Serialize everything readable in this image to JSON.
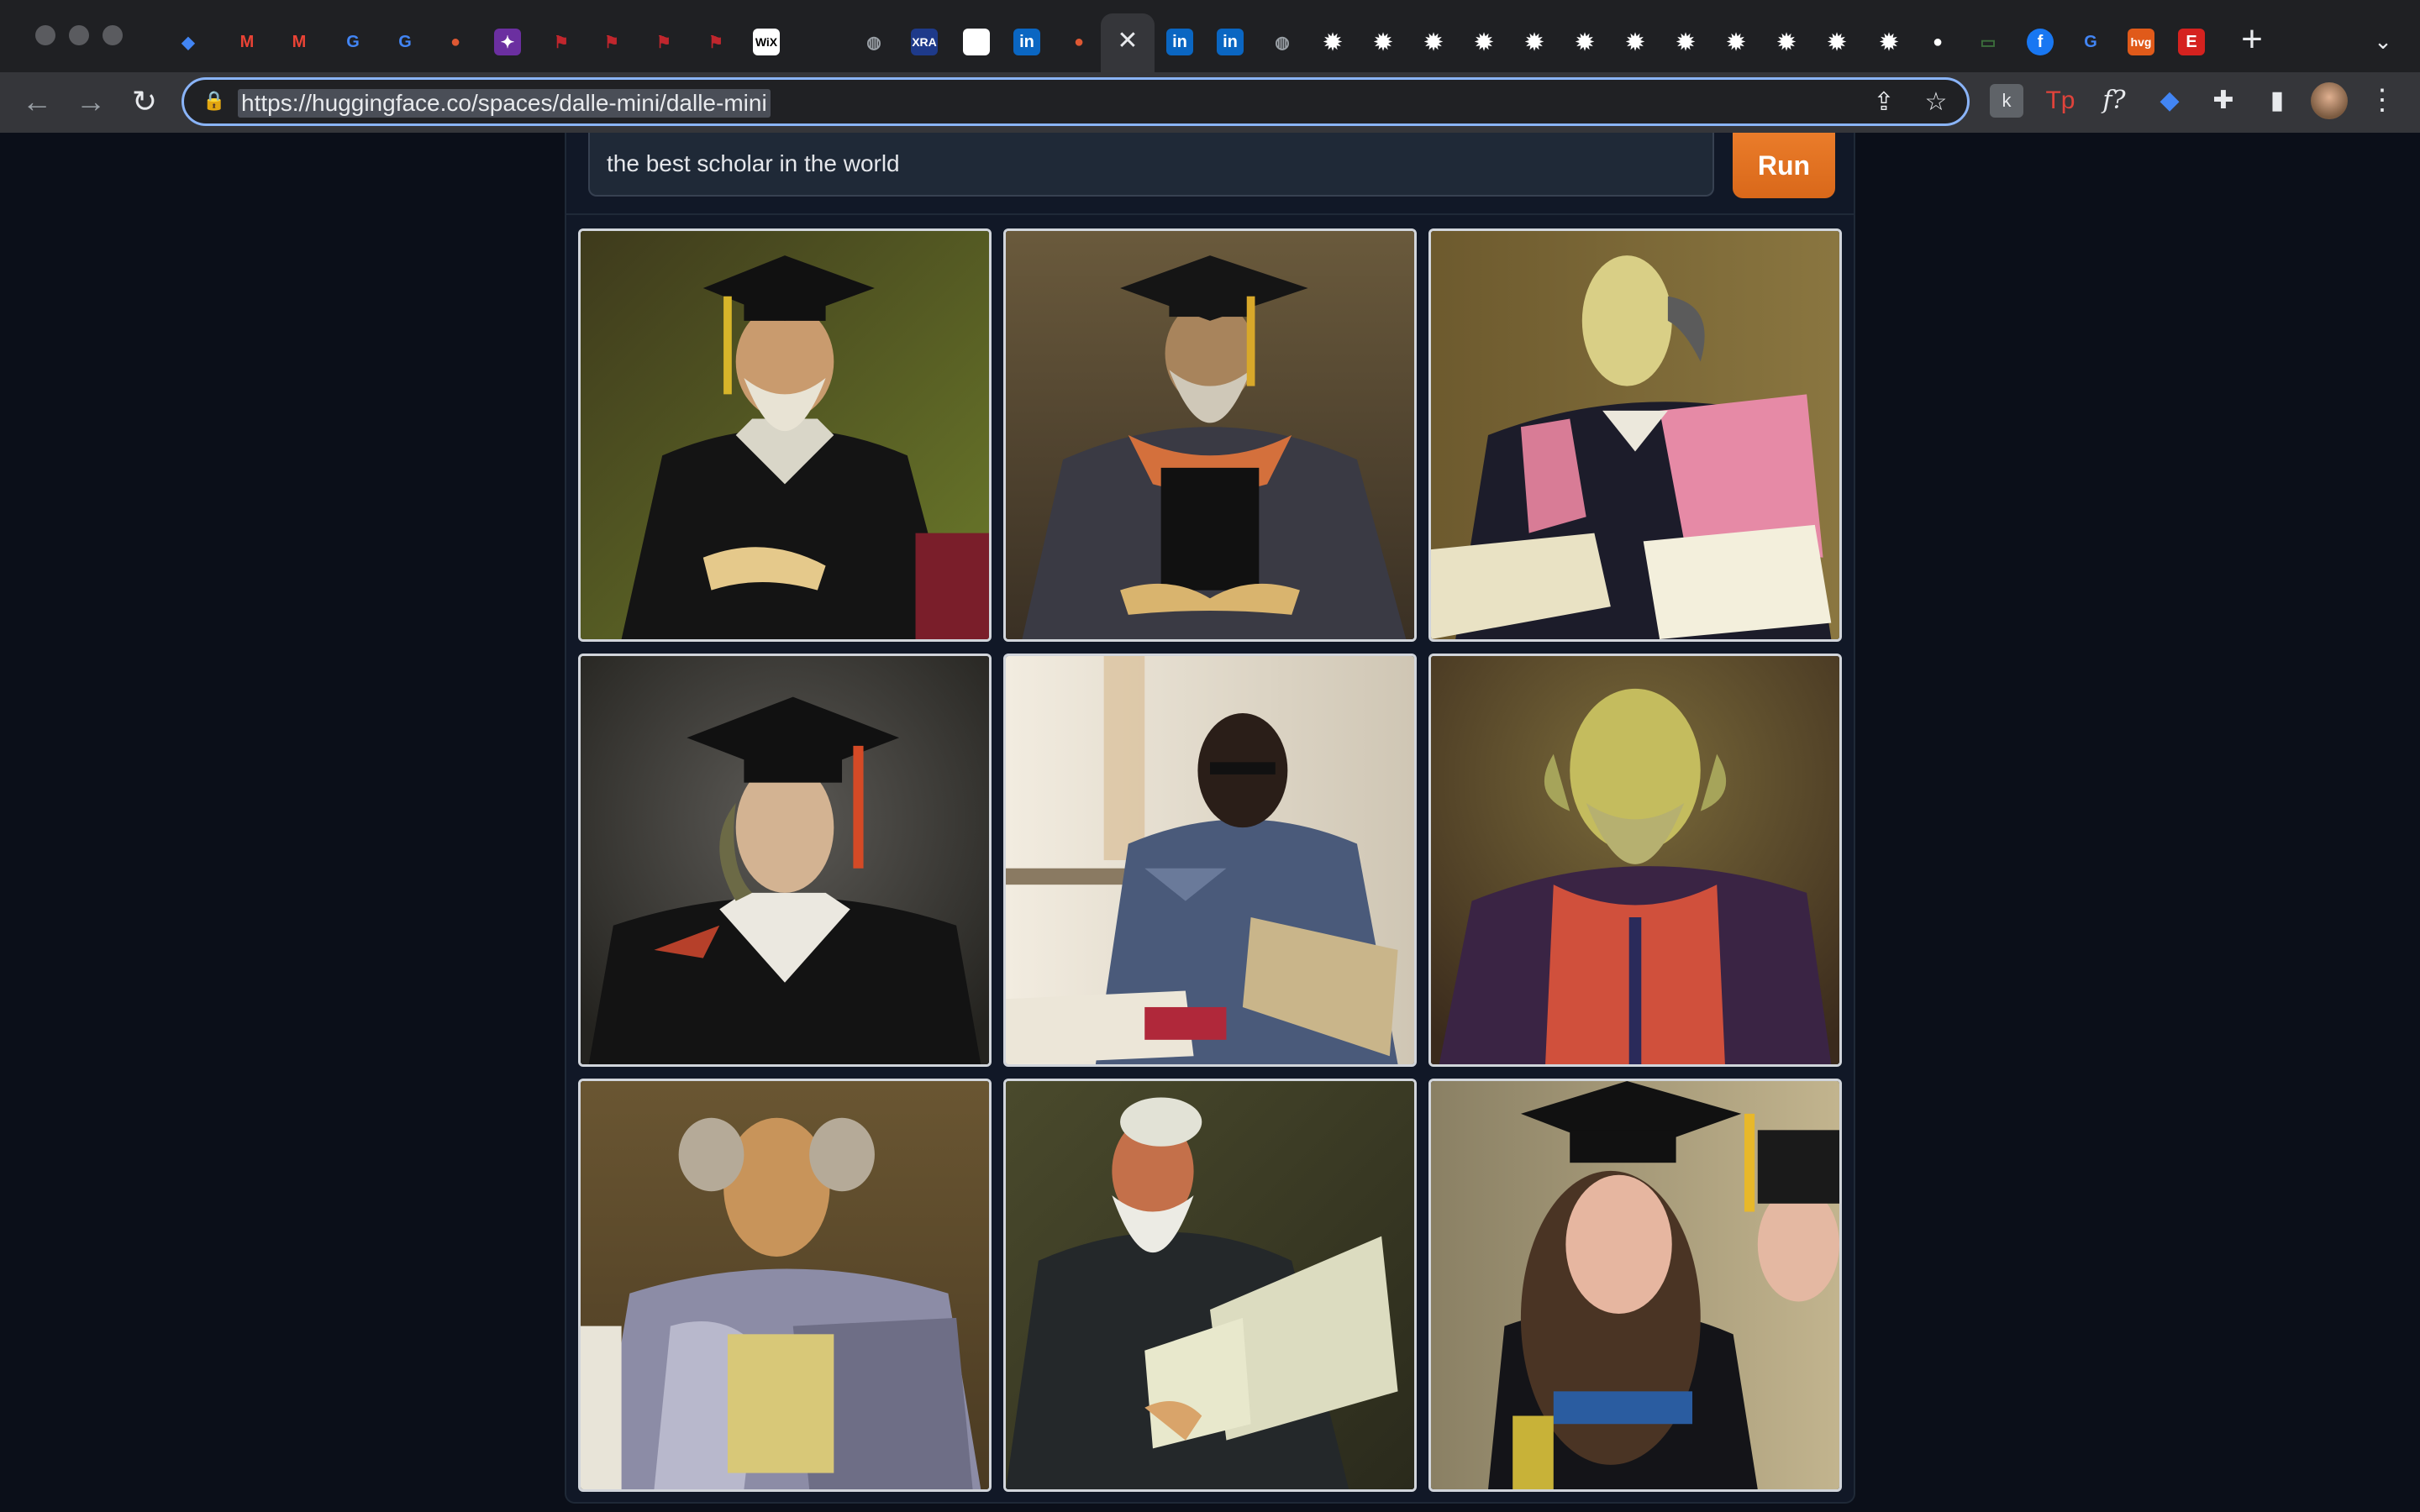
{
  "browser": {
    "url": "https://huggingface.co/spaces/dalle-mini/dalle-mini",
    "tabs": [
      {
        "icon": "gem-icon",
        "color": "#4285f4"
      },
      {
        "icon": "gmail-icon",
        "color": "#ea4335"
      },
      {
        "icon": "gmail-icon",
        "color": "#ea4335"
      },
      {
        "icon": "google-icon",
        "color": "#4285f4"
      },
      {
        "icon": "google-icon",
        "color": "#4285f4"
      },
      {
        "icon": "duckduckgo-icon",
        "color": "#de5833"
      },
      {
        "icon": "purple-app-icon",
        "color": "#6b2fa0"
      },
      {
        "icon": "red-pin-icon",
        "color": "#c0262d"
      },
      {
        "icon": "red-pin-icon",
        "color": "#c0262d"
      },
      {
        "icon": "red-pin-icon",
        "color": "#c0262d"
      },
      {
        "icon": "red-pin-icon",
        "color": "#c0262d"
      },
      {
        "icon": "wix-icon",
        "label": "WiX",
        "color": "#ffffff"
      },
      {
        "icon": "globe-icon",
        "color": "#9aa0a6"
      },
      {
        "icon": "xra-icon",
        "label": "XRA",
        "color": "#1e3a8a"
      },
      {
        "icon": "blank-page-icon",
        "color": "#ffffff"
      },
      {
        "icon": "linkedin-icon",
        "label": "in",
        "color": "#0a66c2"
      },
      {
        "icon": "duckduckgo-icon",
        "color": "#de5833"
      },
      {
        "icon": "linkedin-icon",
        "label": "in",
        "color": "#0a66c2"
      },
      {
        "icon": "linkedin-icon",
        "label": "in",
        "color": "#0a66c2"
      },
      {
        "icon": "globe-icon",
        "color": "#9aa0a6"
      },
      {
        "icon": "gear-icon"
      },
      {
        "icon": "gear-icon"
      },
      {
        "icon": "gear-icon"
      },
      {
        "icon": "gear-icon"
      },
      {
        "icon": "gear-icon"
      },
      {
        "icon": "gear-icon"
      },
      {
        "icon": "gear-icon"
      },
      {
        "icon": "gear-icon"
      },
      {
        "icon": "gear-icon"
      },
      {
        "icon": "gear-icon"
      },
      {
        "icon": "gear-icon"
      },
      {
        "icon": "gear-icon"
      },
      {
        "icon": "github-icon",
        "color": "#ffffff"
      },
      {
        "icon": "green-app-icon",
        "color": "#3b6e3b"
      },
      {
        "icon": "facebook-icon",
        "label": "f",
        "color": "#1877f2"
      },
      {
        "icon": "google-icon",
        "color": "#4285f4"
      },
      {
        "icon": "hvg-icon",
        "label": "hvg",
        "color": "#e05a1a"
      },
      {
        "icon": "etsy-icon",
        "label": "E",
        "color": "#d5221f"
      }
    ],
    "extensions": [
      {
        "icon": "k-extension-icon",
        "label": "k",
        "color": "#9aa0a6"
      },
      {
        "icon": "tp-extension-icon",
        "label": "Tp",
        "color": "#e0433b"
      },
      {
        "icon": "fx-extension-icon",
        "label": "f?",
        "color": "#e8eaed"
      },
      {
        "icon": "gem-extension-icon",
        "color": "#4285f4"
      },
      {
        "icon": "puzzle-icon",
        "color": "#e8eaed"
      },
      {
        "icon": "side-panel-icon",
        "color": "#e8eaed"
      }
    ]
  },
  "app": {
    "prompt_value": "the best scholar in the world",
    "run_label": "Run",
    "accent": "#e8711e"
  }
}
